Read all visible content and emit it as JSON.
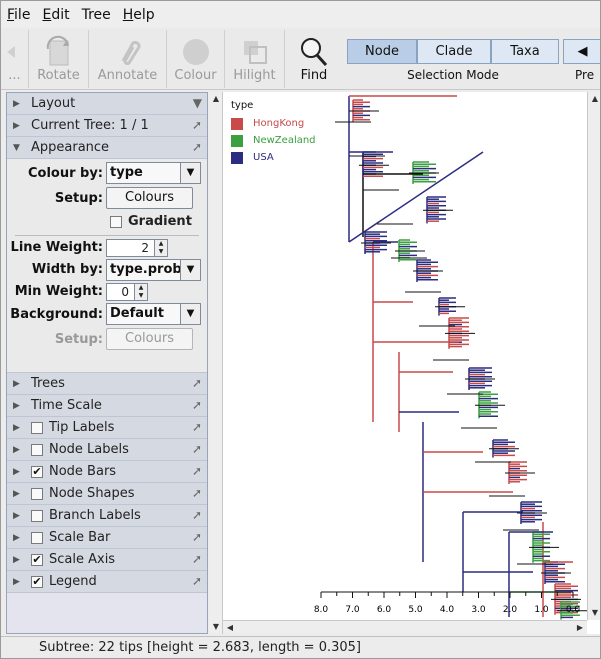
{
  "menu": [
    {
      "u": "F",
      "rest": "ile"
    },
    {
      "u": "E",
      "rest": "dit"
    },
    {
      "u": "",
      "rest": "Tree"
    },
    {
      "u": "H",
      "rest": "elp"
    }
  ],
  "toolbar": {
    "ellipsis": "...",
    "rotate": "Rotate",
    "annotate": "Annotate",
    "colour": "Colour",
    "hilight": "Hilight",
    "find": "Find",
    "node": "Node",
    "clade": "Clade",
    "taxa": "Taxa",
    "selection_mode": "Selection Mode",
    "pre": "Pre"
  },
  "panel": {
    "layout": "Layout",
    "current_tree": "Current Tree: 1 / 1",
    "appearance": "Appearance",
    "colour_by_label": "Colour by:",
    "colour_by_value": "type",
    "setup_label": "Setup:",
    "colours_btn": "Colours",
    "gradient": "Gradient",
    "line_weight_label": "Line Weight:",
    "line_weight_value": "2",
    "width_by_label": "Width by:",
    "width_by_value": "type.prob",
    "min_weight_label": "Min Weight:",
    "min_weight_value": "0",
    "background_label": "Background:",
    "background_value": "Default",
    "setup2_label": "Setup:",
    "colours2_btn": "Colours",
    "trees": "Trees",
    "time_scale": "Time Scale",
    "tip_labels": "Tip Labels",
    "node_labels": "Node Labels",
    "node_bars": "Node Bars",
    "node_shapes": "Node Shapes",
    "branch_labels": "Branch Labels",
    "scale_bar": "Scale Bar",
    "scale_axis": "Scale Axis",
    "legend": "Legend"
  },
  "checks": {
    "tip_labels": false,
    "node_labels": false,
    "node_bars": true,
    "node_shapes": false,
    "branch_labels": false,
    "scale_bar": false,
    "scale_axis": true,
    "legend": true
  },
  "legend": {
    "title": "type",
    "items": [
      {
        "name": "HongKong",
        "color": "#c84a4a"
      },
      {
        "name": "NewZealand",
        "color": "#3aa040"
      },
      {
        "name": "USA",
        "color": "#2c2c80"
      }
    ]
  },
  "axis": {
    "ticks": [
      "8.0",
      "7.0",
      "6.0",
      "5.0",
      "4.0",
      "3.0",
      "2.0",
      "1.0",
      "0.0"
    ]
  },
  "status": "Subtree: 22 tips [height = 2.683, length = 0.305]"
}
